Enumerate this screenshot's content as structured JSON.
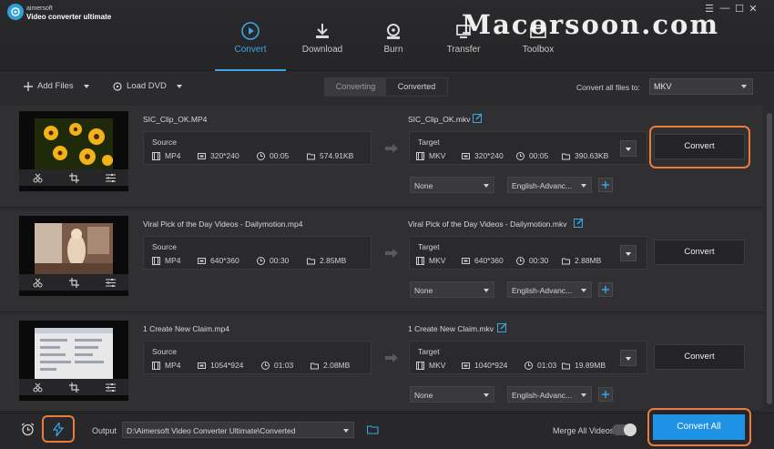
{
  "app": {
    "brand_small": "aimersoft",
    "brand_big": "Video converter ultimate",
    "watermark": "Macorsoon.com"
  },
  "window_controls": [
    "☰",
    "—",
    "☐",
    "✕"
  ],
  "nav": [
    {
      "label": "Convert",
      "icon": "convert-icon",
      "active": true
    },
    {
      "label": "Download",
      "icon": "download-icon",
      "active": false
    },
    {
      "label": "Burn",
      "icon": "burn-icon",
      "active": false
    },
    {
      "label": "Transfer",
      "icon": "transfer-icon",
      "active": false
    },
    {
      "label": "Toolbox",
      "icon": "toolbox-icon",
      "active": false
    }
  ],
  "toolbar": {
    "add_files": "Add Files",
    "load_dvd": "Load DVD",
    "tab_converting": "Converting",
    "tab_converted": "Converted",
    "convert_all_label": "Convert all files to:",
    "format_value": "MKV"
  },
  "items": [
    {
      "source_name": "SIC_Clip_OK.MP4",
      "target_name": "SIC_Clip_OK.mkv",
      "source": {
        "label": "Source",
        "format": "MP4",
        "resolution": "320*240",
        "duration": "00:05",
        "size": "574.91KB"
      },
      "target": {
        "label": "Target",
        "format": "MKV",
        "resolution": "320*240",
        "duration": "00:05",
        "size": "390.63KB"
      },
      "subtitle": "None",
      "audio": "English-Advanc...",
      "button": "Convert",
      "highlighted": true
    },
    {
      "source_name": "Viral Pick of the Day Videos - Dailymotion.mp4",
      "target_name": "Viral Pick of the Day Videos - Dailymotion.mkv",
      "source": {
        "label": "Source",
        "format": "MP4",
        "resolution": "640*360",
        "duration": "00:30",
        "size": "2.85MB"
      },
      "target": {
        "label": "Target",
        "format": "MKV",
        "resolution": "640*360",
        "duration": "00:30",
        "size": "2.88MB"
      },
      "subtitle": "None",
      "audio": "English-Advanc...",
      "button": "Convert",
      "highlighted": false
    },
    {
      "source_name": "1 Create New Claim.mp4",
      "target_name": "1 Create New Claim.mkv",
      "source": {
        "label": "Source",
        "format": "MP4",
        "resolution": "1054*924",
        "duration": "01:03",
        "size": "2.08MB"
      },
      "target": {
        "label": "Target",
        "format": "MKV",
        "resolution": "1040*924",
        "duration": "01:03",
        "size": "19.89MB"
      },
      "subtitle": "None",
      "audio": "English-Advanc...",
      "button": "Convert",
      "highlighted": false
    }
  ],
  "bottom": {
    "output_label": "Output",
    "output_path": "D:\\Aimersoft Video Converter Ultimate\\Converted",
    "merge_label": "Merge All Videos",
    "convert_all": "Convert All"
  },
  "colors": {
    "accent": "#3aa6e4",
    "highlight": "#ea7b3f",
    "convert_all_bg": "#1e93e6"
  }
}
